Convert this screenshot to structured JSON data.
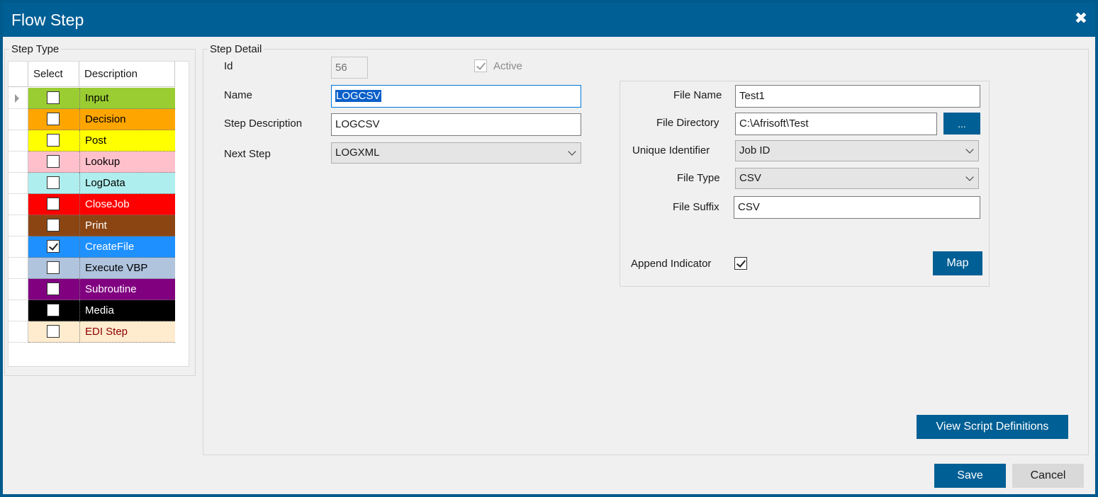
{
  "window": {
    "title": "Flow Step"
  },
  "step_type": {
    "legend": "Step Type",
    "columns": {
      "select": "Select",
      "description": "Description"
    },
    "rows": [
      {
        "label": "Input",
        "checked": false,
        "bg": "#9acd32",
        "fg": "#000000"
      },
      {
        "label": "Decision",
        "checked": false,
        "bg": "#ffa500",
        "fg": "#000000"
      },
      {
        "label": "Post",
        "checked": false,
        "bg": "#ffff00",
        "fg": "#000000"
      },
      {
        "label": "Lookup",
        "checked": false,
        "bg": "#ffc0cb",
        "fg": "#000000"
      },
      {
        "label": "LogData",
        "checked": false,
        "bg": "#afeeee",
        "fg": "#000000"
      },
      {
        "label": "CloseJob",
        "checked": false,
        "bg": "#ff0000",
        "fg": "#ffffff"
      },
      {
        "label": "Print",
        "checked": false,
        "bg": "#8b4513",
        "fg": "#ffffff"
      },
      {
        "label": "CreateFile",
        "checked": true,
        "bg": "#1e90ff",
        "fg": "#ffffff"
      },
      {
        "label": "Execute VBP",
        "checked": false,
        "bg": "#b0c4de",
        "fg": "#000000"
      },
      {
        "label": "Subroutine",
        "checked": false,
        "bg": "#800080",
        "fg": "#ffffff"
      },
      {
        "label": "Media",
        "checked": false,
        "bg": "#000000",
        "fg": "#ffffff"
      },
      {
        "label": "EDI Step",
        "checked": false,
        "bg": "#ffebcd",
        "fg": "#8b0000"
      }
    ]
  },
  "step_detail": {
    "legend": "Step Detail",
    "id_label": "Id",
    "id_value": "56",
    "active_label": "Active",
    "active_checked": true,
    "name_label": "Name",
    "name_value": "LOGCSV",
    "description_label": "Step Description",
    "description_value": "LOGCSV",
    "next_step_label": "Next Step",
    "next_step_value": "LOGXML"
  },
  "file_panel": {
    "file_name_label": "File Name",
    "file_name_value": "Test1",
    "file_directory_label": "File Directory",
    "file_directory_value": "C:\\Afrisoft\\Test",
    "browse_label": "...",
    "unique_identifier_label": "Unique Identifier",
    "unique_identifier_value": "Job ID",
    "file_type_label": "File Type",
    "file_type_value": "CSV",
    "file_suffix_label": "File Suffix",
    "file_suffix_value": "CSV",
    "append_indicator_label": "Append Indicator",
    "append_indicator_checked": true,
    "map_label": "Map"
  },
  "buttons": {
    "view_script": "View Script Definitions",
    "save": "Save",
    "cancel": "Cancel"
  },
  "colors": {
    "accent": "#005f95"
  }
}
